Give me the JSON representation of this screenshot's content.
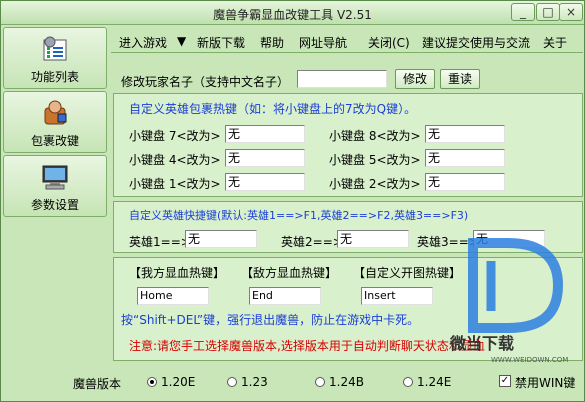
{
  "window": {
    "title": "魔兽争霸显血改键工具 V2.51",
    "min_label": "_",
    "max_label": "□",
    "close_label": "×"
  },
  "sidebar": {
    "items": [
      {
        "label": "功能列表",
        "icon": "settings-list-icon"
      },
      {
        "label": "包裹改键",
        "icon": "backpack-user-icon"
      },
      {
        "label": "参数设置",
        "icon": "computer-icon"
      }
    ]
  },
  "menu": {
    "items": [
      "进入游戏",
      "▼",
      "新版下载",
      "帮助",
      "网址导航",
      "关闭(C)",
      "建议提交使用与交流",
      "关于"
    ]
  },
  "rename": {
    "label": "修改玩家名子（支持中文名子）",
    "value": "",
    "modify_button": "修改",
    "reset_button": "重读"
  },
  "inventory": {
    "heading": "自定义英雄包裹热键（如：将小键盘上的7改为Q键）。",
    "rows": [
      {
        "left_label": "小键盘 7<改为>",
        "left_value": "无",
        "right_label": "小键盘 8<改为>",
        "right_value": "无"
      },
      {
        "left_label": "小键盘 4<改为>",
        "left_value": "无",
        "right_label": "小键盘 5<改为>",
        "right_value": "无"
      },
      {
        "left_label": "小键盘 1<改为>",
        "left_value": "无",
        "right_label": "小键盘 2<改为>",
        "right_value": "无"
      }
    ]
  },
  "hero": {
    "heading": "自定义英雄快捷键(默认:英雄1==>F1,英雄2==>F2,英雄3==>F3)",
    "items": [
      {
        "label": "英雄1==>",
        "value": "无"
      },
      {
        "label": "英雄2==>",
        "value": "无"
      },
      {
        "label": "英雄3==>",
        "value": "无"
      }
    ]
  },
  "hotkeys": {
    "my_hp_label": "【我方显血热键】",
    "enemy_hp_label": "【敌方显血热键】",
    "custom_label": "【自定义开图热键】",
    "my_hp_value": "Home",
    "enemy_hp_value": "End",
    "custom_value": "Insert",
    "note": "按“Shift+DEL”键，强行退出魔兽，防止在游戏中卡死。",
    "warning": "注意:请您手工选择魔兽版本,选择版本用于自动判断聊天状态和显血"
  },
  "version": {
    "label": "魔兽版本",
    "options": [
      "1.20E",
      "1.23",
      "1.24B",
      "1.24E"
    ],
    "selected": "1.20E",
    "disable_win_label": "禁用WIN键",
    "disable_win_checked": true
  },
  "watermark": {
    "brand": "微当下载",
    "url": "WWW.WEIDOWN.COM"
  },
  "colors": {
    "background": "#c8e6b8",
    "panel": "#d9f0cc",
    "heading_blue": "#1a3fd6",
    "warning_red": "#d60000",
    "watermark_blue": "#2b7fe0"
  }
}
